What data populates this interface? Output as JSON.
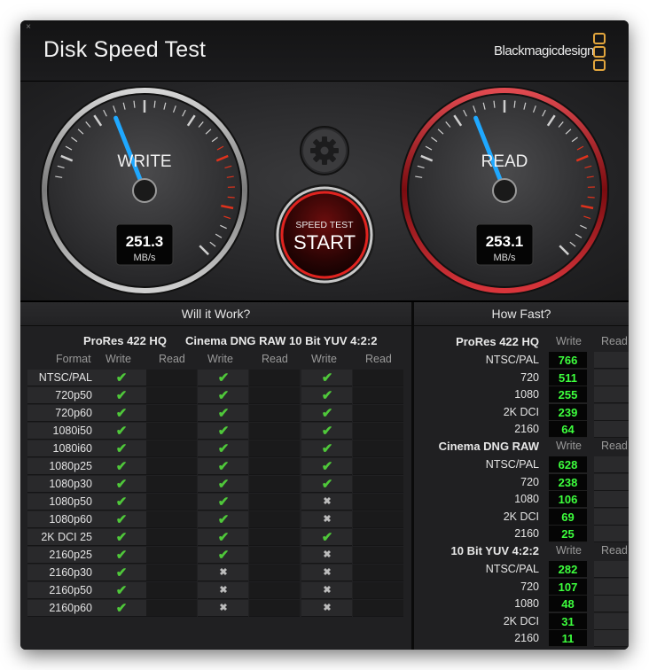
{
  "app": {
    "title": "Disk Speed Test",
    "brand": "Blackmagicdesign",
    "close_glyph": "×"
  },
  "gauges": {
    "write": {
      "label": "WRITE",
      "value": "251.3",
      "unit": "MB/s",
      "needle_fraction": 0.42
    },
    "read": {
      "label": "READ",
      "value": "253.1",
      "unit": "MB/s",
      "needle_fraction": 0.42
    }
  },
  "start_button": {
    "line1": "SPEED TEST",
    "line2": "START"
  },
  "will_it_work": {
    "title": "Will it Work?",
    "format_label": "Format",
    "codecs": [
      {
        "name": "ProRes 422 HQ",
        "write": "Write",
        "read": "Read"
      },
      {
        "name": "Cinema DNG RAW",
        "write": "Write",
        "read": "Read"
      },
      {
        "name": "10 Bit YUV 4:2:2",
        "write": "Write",
        "read": "Read"
      }
    ],
    "rows": [
      {
        "format": "NTSC/PAL",
        "marks": [
          "check",
          "check",
          "check"
        ]
      },
      {
        "format": "720p50",
        "marks": [
          "check",
          "check",
          "check"
        ]
      },
      {
        "format": "720p60",
        "marks": [
          "check",
          "check",
          "check"
        ]
      },
      {
        "format": "1080i50",
        "marks": [
          "check",
          "check",
          "check"
        ]
      },
      {
        "format": "1080i60",
        "marks": [
          "check",
          "check",
          "check"
        ]
      },
      {
        "format": "1080p25",
        "marks": [
          "check",
          "check",
          "check"
        ]
      },
      {
        "format": "1080p30",
        "marks": [
          "check",
          "check",
          "check"
        ]
      },
      {
        "format": "1080p50",
        "marks": [
          "check",
          "check",
          "cross"
        ]
      },
      {
        "format": "1080p60",
        "marks": [
          "check",
          "check",
          "cross"
        ]
      },
      {
        "format": "2K DCI 25",
        "marks": [
          "check",
          "check",
          "check"
        ]
      },
      {
        "format": "2160p25",
        "marks": [
          "check",
          "check",
          "cross"
        ]
      },
      {
        "format": "2160p30",
        "marks": [
          "check",
          "cross",
          "cross"
        ]
      },
      {
        "format": "2160p50",
        "marks": [
          "check",
          "cross",
          "cross"
        ]
      },
      {
        "format": "2160p60",
        "marks": [
          "check",
          "cross",
          "cross"
        ]
      }
    ]
  },
  "how_fast": {
    "title": "How Fast?",
    "groups": [
      {
        "name": "ProRes 422 HQ",
        "write": "Write",
        "read": "Read",
        "rows": [
          {
            "label": "NTSC/PAL",
            "value": "766"
          },
          {
            "label": "720",
            "value": "511"
          },
          {
            "label": "1080",
            "value": "255"
          },
          {
            "label": "2K DCI",
            "value": "239"
          },
          {
            "label": "2160",
            "value": "64"
          }
        ]
      },
      {
        "name": "Cinema DNG RAW",
        "write": "Write",
        "read": "Read",
        "rows": [
          {
            "label": "NTSC/PAL",
            "value": "628"
          },
          {
            "label": "720",
            "value": "238"
          },
          {
            "label": "1080",
            "value": "106"
          },
          {
            "label": "2K DCI",
            "value": "69"
          },
          {
            "label": "2160",
            "value": "25"
          }
        ]
      },
      {
        "name": "10 Bit YUV 4:2:2",
        "write": "Write",
        "read": "Read",
        "rows": [
          {
            "label": "NTSC/PAL",
            "value": "282"
          },
          {
            "label": "720",
            "value": "107"
          },
          {
            "label": "1080",
            "value": "48"
          },
          {
            "label": "2K DCI",
            "value": "31"
          },
          {
            "label": "2160",
            "value": "11"
          }
        ]
      }
    ]
  },
  "glyphs": {
    "check": "✔",
    "cross": "✖"
  },
  "colors": {
    "needle": "#1fa8ff",
    "value_green": "#3dff3d",
    "check_green": "#4fc83a",
    "logo_orange": "#e3a63d",
    "read_ring": "#b3141a",
    "redzone": "#e0321c"
  }
}
